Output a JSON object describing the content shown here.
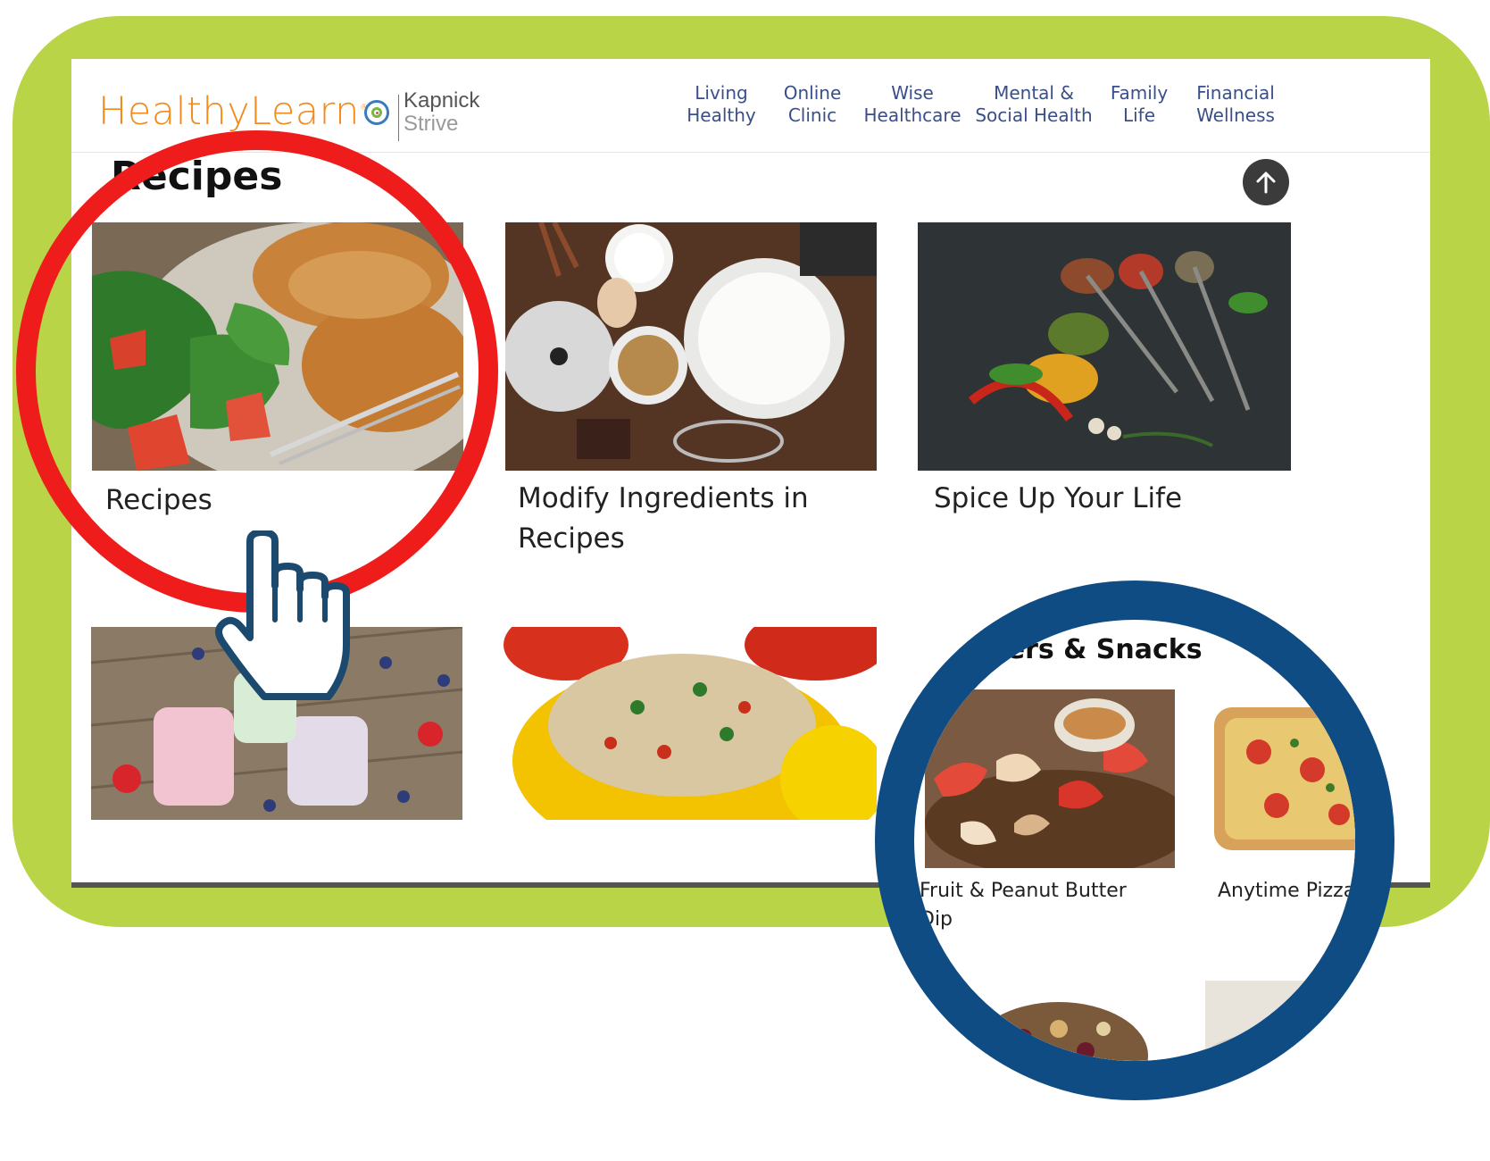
{
  "header": {
    "logo_text": "HealthyLearn",
    "logo_mark": "®",
    "partner_line1": "Kapnick",
    "partner_line2": "Strive",
    "nav": [
      {
        "line1": "Living",
        "line2": "Healthy"
      },
      {
        "line1": "Online",
        "line2": "Clinic"
      },
      {
        "line1": "Wise",
        "line2": "Healthcare"
      },
      {
        "line1": "Mental &",
        "line2": "Social Health"
      },
      {
        "line1": "Family",
        "line2": "Life"
      },
      {
        "line1": "Financial",
        "line2": "Wellness"
      }
    ]
  },
  "page": {
    "title": "Recipes",
    "cards": [
      {
        "title": "Recipes"
      },
      {
        "title": "Modify Ingredients in Recipes"
      },
      {
        "title": "Spice Up Your Life"
      }
    ]
  },
  "zoom": {
    "title": "izers & Snacks",
    "items": [
      {
        "label": "Fruit & Peanut Butter Dip"
      },
      {
        "label": "Anytime Pizza"
      }
    ]
  },
  "colors": {
    "frame": "#b9d446",
    "highlight_ring": "#ef1c1c",
    "zoom_ring": "#0f4c84",
    "logo": "#f28b1e",
    "nav_text": "#3a4f8a"
  },
  "icons": {
    "pointer": "hand-pointer-icon",
    "scroll_top": "arrow-up-icon",
    "brand": "target-icon"
  }
}
